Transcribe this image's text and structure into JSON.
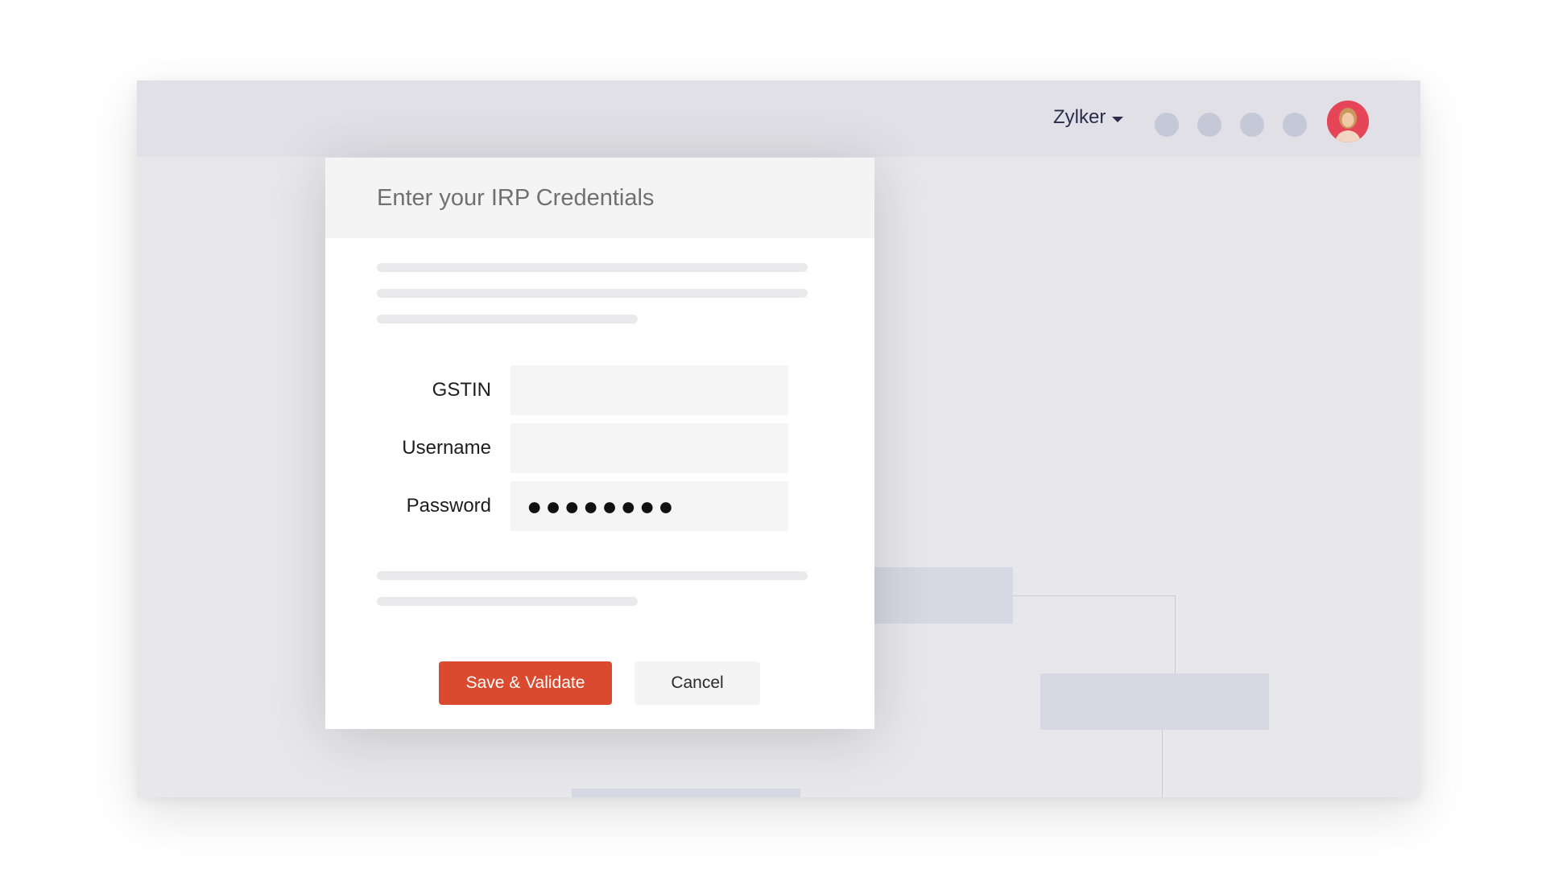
{
  "topbar": {
    "org_name": "Zylker",
    "icons": [
      "app-icon-1",
      "app-icon-2",
      "app-icon-3",
      "app-icon-4"
    ],
    "avatar": "user-avatar"
  },
  "modal": {
    "title": "Enter your IRP Credentials",
    "fields": {
      "gstin_label": "GSTIN",
      "gstin_value": "",
      "username_label": "Username",
      "username_value": "",
      "password_label": "Password",
      "password_value": "●●●●●●●●"
    },
    "buttons": {
      "save": "Save & Validate",
      "cancel": "Cancel"
    }
  },
  "colors": {
    "primary": "#d94a2e",
    "backdrop": "#e8e8ec",
    "topbar": "#e0e0e6"
  }
}
